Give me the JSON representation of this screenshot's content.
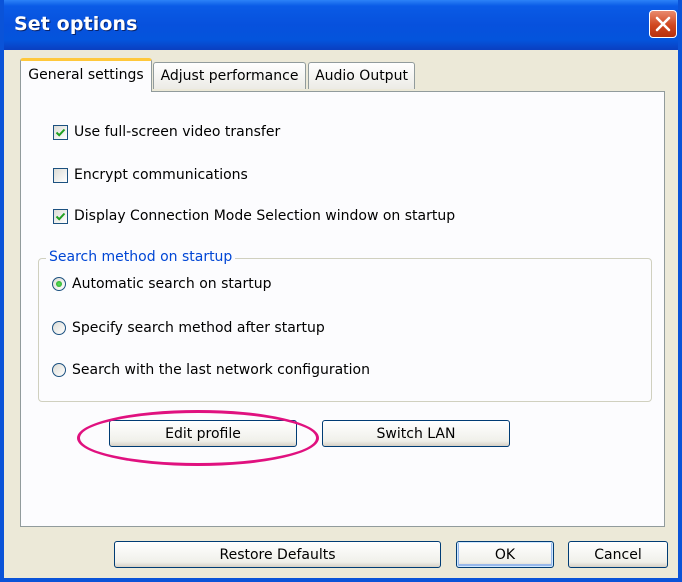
{
  "window": {
    "title": "Set options"
  },
  "tabs": [
    {
      "label": "General settings",
      "active": true
    },
    {
      "label": "Adjust performance",
      "active": false
    },
    {
      "label": "Audio Output",
      "active": false
    }
  ],
  "checkboxes": [
    {
      "label": "Use full-screen video transfer",
      "checked": true
    },
    {
      "label": "Encrypt communications",
      "checked": false
    },
    {
      "label": "Display Connection Mode Selection window on startup",
      "checked": true
    }
  ],
  "search_group": {
    "legend": "Search method on startup",
    "options": [
      {
        "label": "Automatic search on startup",
        "selected": true
      },
      {
        "label": "Specify search method after startup",
        "selected": false
      },
      {
        "label": "Search with the last network configuration",
        "selected": false
      }
    ]
  },
  "panel_buttons": {
    "edit_profile": "Edit profile",
    "switch_lan": "Switch LAN"
  },
  "footer_buttons": {
    "restore": "Restore Defaults",
    "ok": "OK",
    "cancel": "Cancel"
  },
  "colors": {
    "titlebar": "#0751dd",
    "highlight": "#e0117f",
    "group_legend": "#0046d5",
    "active_tab_accent": "#ffc83c"
  }
}
